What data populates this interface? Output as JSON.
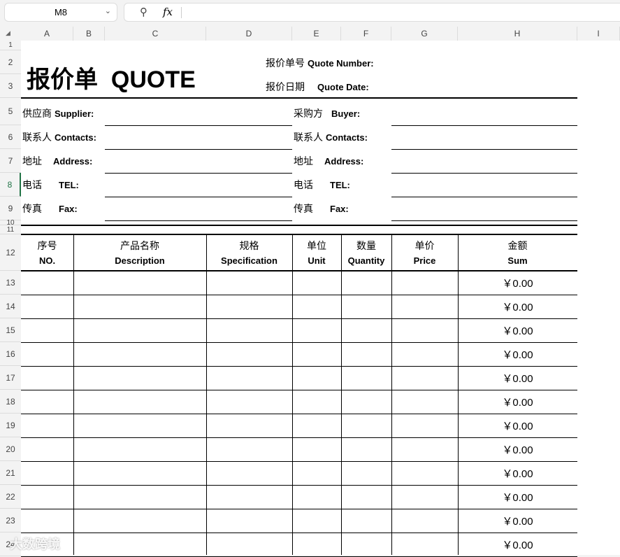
{
  "formula_bar": {
    "cell_ref": "M8",
    "zoom_icon": "zoom-icon",
    "fx_label": "fx",
    "formula": ""
  },
  "columns": [
    "A",
    "B",
    "C",
    "D",
    "E",
    "F",
    "G",
    "H",
    "I"
  ],
  "rows": [
    "1",
    "2",
    "3",
    "5",
    "6",
    "7",
    "8",
    "9",
    "10",
    "11",
    "12",
    "13",
    "14",
    "15",
    "16",
    "17",
    "18",
    "19",
    "20",
    "21",
    "22",
    "23",
    "24"
  ],
  "title": "报价单  QUOTE",
  "quote_number": {
    "cn": "报价单号",
    "en": "Quote Number:"
  },
  "quote_date": {
    "cn": "报价日期",
    "en": "Quote Date:"
  },
  "left_fields": [
    {
      "cn": "供应商",
      "en": "Supplier:"
    },
    {
      "cn": "联系人",
      "en": "Contacts:"
    },
    {
      "cn": "地址",
      "en": "Address:"
    },
    {
      "cn": "电话",
      "en": "TEL:"
    },
    {
      "cn": "传真",
      "en": "Fax:"
    }
  ],
  "right_fields": [
    {
      "cn": "采购方",
      "en": "Buyer:"
    },
    {
      "cn": "联系人",
      "en": "Contacts:"
    },
    {
      "cn": "地址",
      "en": "Address:"
    },
    {
      "cn": "电话",
      "en": "TEL:"
    },
    {
      "cn": "传真",
      "en": "Fax:"
    }
  ],
  "table_headers": [
    {
      "cn": "序号",
      "en": "NO."
    },
    {
      "cn": "产品名称",
      "en": "Description"
    },
    {
      "cn": "规格",
      "en": "Specification"
    },
    {
      "cn": "单位",
      "en": "Unit"
    },
    {
      "cn": "数量",
      "en": "Quantity"
    },
    {
      "cn": "单价",
      "en": "Price"
    },
    {
      "cn": "金额",
      "en": "Sum"
    }
  ],
  "sums": [
    "￥0.00",
    "￥0.00",
    "￥0.00",
    "￥0.00",
    "￥0.00",
    "￥0.00",
    "￥0.00",
    "￥0.00",
    "￥0.00",
    "￥0.00",
    "￥0.00",
    "￥0.00"
  ],
  "watermark": "大数跨境"
}
